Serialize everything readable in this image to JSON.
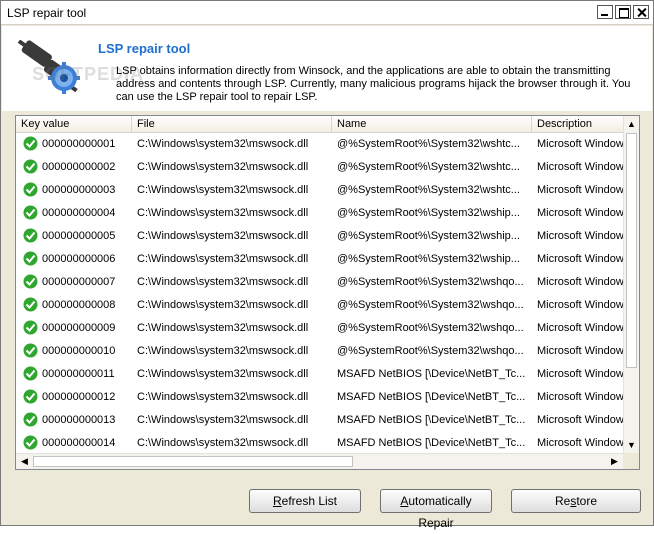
{
  "window": {
    "title": "LSP repair tool"
  },
  "header": {
    "title": "LSP repair tool",
    "description": "LSP obtains information directly from Winsock, and the applications are able to obtain the transmitting address and contents through LSP. Currently, many malicious programs hijack the browser through it. You can use the LSP repair tool to repair LSP.",
    "watermark": "SOFTPEDIA"
  },
  "table": {
    "columns": [
      "Key value",
      "File",
      "Name",
      "Description"
    ],
    "rows": [
      [
        "000000000001",
        "C:\\Windows\\system32\\mswsock.dll",
        "@%SystemRoot%\\System32\\wshtc...",
        "Microsoft Window"
      ],
      [
        "000000000002",
        "C:\\Windows\\system32\\mswsock.dll",
        "@%SystemRoot%\\System32\\wshtc...",
        "Microsoft Window"
      ],
      [
        "000000000003",
        "C:\\Windows\\system32\\mswsock.dll",
        "@%SystemRoot%\\System32\\wshtc...",
        "Microsoft Window"
      ],
      [
        "000000000004",
        "C:\\Windows\\system32\\mswsock.dll",
        "@%SystemRoot%\\System32\\wship...",
        "Microsoft Window"
      ],
      [
        "000000000005",
        "C:\\Windows\\system32\\mswsock.dll",
        "@%SystemRoot%\\System32\\wship...",
        "Microsoft Window"
      ],
      [
        "000000000006",
        "C:\\Windows\\system32\\mswsock.dll",
        "@%SystemRoot%\\System32\\wship...",
        "Microsoft Window"
      ],
      [
        "000000000007",
        "C:\\Windows\\system32\\mswsock.dll",
        "@%SystemRoot%\\System32\\wshqo...",
        "Microsoft Window"
      ],
      [
        "000000000008",
        "C:\\Windows\\system32\\mswsock.dll",
        "@%SystemRoot%\\System32\\wshqo...",
        "Microsoft Window"
      ],
      [
        "000000000009",
        "C:\\Windows\\system32\\mswsock.dll",
        "@%SystemRoot%\\System32\\wshqo...",
        "Microsoft Window"
      ],
      [
        "000000000010",
        "C:\\Windows\\system32\\mswsock.dll",
        "@%SystemRoot%\\System32\\wshqo...",
        "Microsoft Window"
      ],
      [
        "000000000011",
        "C:\\Windows\\system32\\mswsock.dll",
        "MSAFD NetBIOS [\\Device\\NetBT_Tc...",
        "Microsoft Window"
      ],
      [
        "000000000012",
        "C:\\Windows\\system32\\mswsock.dll",
        "MSAFD NetBIOS [\\Device\\NetBT_Tc...",
        "Microsoft Window"
      ],
      [
        "000000000013",
        "C:\\Windows\\system32\\mswsock.dll",
        "MSAFD NetBIOS [\\Device\\NetBT_Tc...",
        "Microsoft Window"
      ],
      [
        "000000000014",
        "C:\\Windows\\system32\\mswsock.dll",
        "MSAFD NetBIOS [\\Device\\NetBT_Tc...",
        "Microsoft Window"
      ]
    ]
  },
  "buttons": {
    "refresh": {
      "pre": "",
      "key": "R",
      "post": "efresh List"
    },
    "auto": {
      "pre": "",
      "key": "A",
      "post": "utomatically Repair"
    },
    "restore": {
      "pre": "Re",
      "key": "s",
      "post": "tore"
    }
  },
  "colors": {
    "title_blue": "#1e6fd0",
    "ok_green": "#2fa62f"
  }
}
